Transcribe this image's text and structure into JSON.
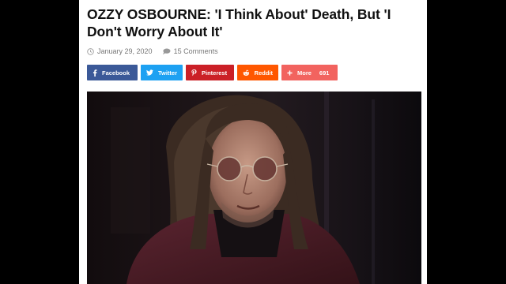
{
  "article": {
    "title": "OZZY OSBOURNE: 'I Think About' Death, But 'I Don't Worry About It'",
    "date": "January 29, 2020",
    "comments": "15 Comments",
    "date_icon": "clock-icon",
    "comments_icon": "comment-bubble-icon"
  },
  "share": {
    "facebook": "Facebook",
    "twitter": "Twitter",
    "pinterest": "Pinterest",
    "reddit": "Reddit",
    "more": "More",
    "more_count": "691"
  },
  "colors": {
    "facebook": "#3b5998",
    "twitter": "#1da1f2",
    "pinterest": "#cb2027",
    "reddit": "#ff5700",
    "more": "#f2635f"
  }
}
